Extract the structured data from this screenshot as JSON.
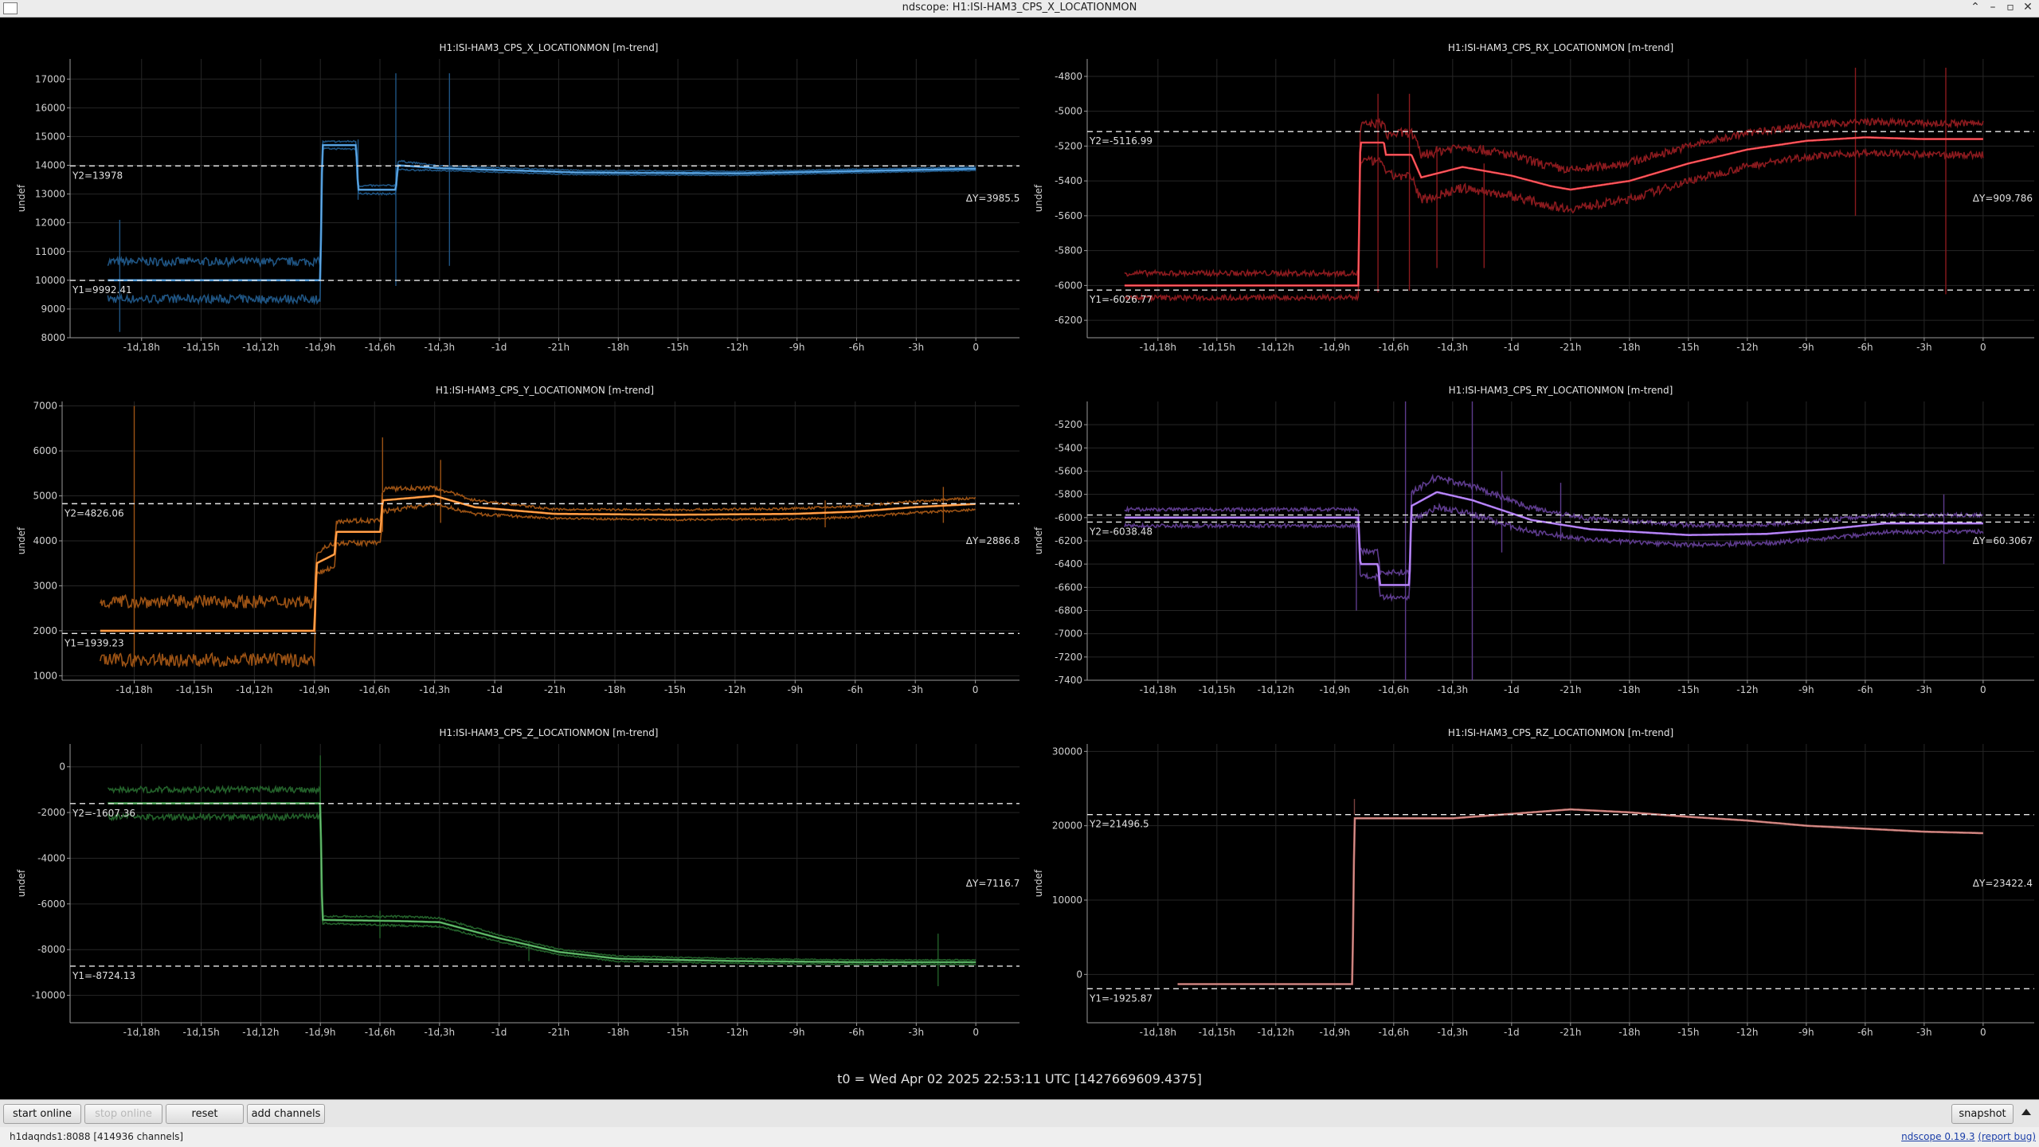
{
  "window": {
    "title": "ndscope: H1:ISI-HAM3_CPS_X_LOCATIONMON",
    "controls": [
      "⌃",
      "–",
      "▫",
      "✕"
    ]
  },
  "time_ticks": [
    "-1d,18h",
    "-1d,15h",
    "-1d,12h",
    "-1d,9h",
    "-1d,6h",
    "-1d,3h",
    "-1d",
    "-21h",
    "-18h",
    "-15h",
    "-12h",
    "-9h",
    "-6h",
    "-3h",
    "0"
  ],
  "time_tick_hours": [
    -42,
    -39,
    -36,
    -33,
    -30,
    -27,
    -24,
    -21,
    -18,
    -15,
    -12,
    -9,
    -6,
    -3,
    0
  ],
  "ylabel": "undef",
  "plots": [
    {
      "id": "x",
      "title": "H1:ISI-HAM3_CPS_X_LOCATIONMON [m-trend]",
      "color": "#3a8fd6",
      "dim_color": "#1f5482",
      "ylim": [
        8000,
        17700
      ],
      "yticks": [
        8000,
        9000,
        10000,
        11000,
        12000,
        13000,
        14000,
        15000,
        16000,
        17000
      ],
      "y1": 9992.41,
      "y1_label": "Y1=9992.41",
      "y2": 13978,
      "y2_label": "Y2=13978",
      "delta_label": "ΔY=3985.55",
      "profile": [
        [
          -43.7,
          10000
        ],
        [
          -33.0,
          10000
        ],
        [
          -32.9,
          14700
        ],
        [
          -31.2,
          14700
        ],
        [
          -31.1,
          13150
        ],
        [
          -29.2,
          13150
        ],
        [
          -29.1,
          14000
        ],
        [
          -27.0,
          13900
        ],
        [
          -20,
          13750
        ],
        [
          -12,
          13720
        ],
        [
          -6,
          13800
        ],
        [
          0,
          13880
        ]
      ],
      "band": [
        [
          -43.7,
          650
        ],
        [
          -33,
          650
        ],
        [
          -32.9,
          120
        ],
        [
          -29,
          150
        ],
        [
          -27,
          80
        ],
        [
          0,
          60
        ]
      ],
      "spikes": [
        [
          -29.2,
          9800,
          17200
        ],
        [
          -26.5,
          10500,
          17200
        ],
        [
          -43.1,
          8200,
          12100
        ],
        [
          -31.1,
          12800,
          14900
        ]
      ]
    },
    {
      "id": "rx",
      "title": "H1:ISI-HAM3_CPS_RX_LOCATIONMON [m-trend]",
      "color": "#f0343b",
      "dim_color": "#8a1a1e",
      "ylim": [
        -6300,
        -4700
      ],
      "yticks": [
        -6200,
        -6000,
        -5800,
        -5600,
        -5400,
        -5200,
        -5000,
        -4800
      ],
      "y1": -6026.77,
      "y1_label": "Y1=-6026.77",
      "y2": -5116.99,
      "y2_label": "Y2=-5116.99",
      "delta_label": "ΔY=909.786",
      "profile": [
        [
          -43.7,
          -6000
        ],
        [
          -31.8,
          -6000
        ],
        [
          -31.7,
          -5180
        ],
        [
          -30.5,
          -5180
        ],
        [
          -30.4,
          -5250
        ],
        [
          -29.1,
          -5250
        ],
        [
          -28.6,
          -5380
        ],
        [
          -26.5,
          -5320
        ],
        [
          -24,
          -5370
        ],
        [
          -22,
          -5430
        ],
        [
          -21,
          -5450
        ],
        [
          -18,
          -5400
        ],
        [
          -15,
          -5300
        ],
        [
          -12,
          -5220
        ],
        [
          -9,
          -5170
        ],
        [
          -6,
          -5150
        ],
        [
          -3,
          -5160
        ],
        [
          0,
          -5160
        ]
      ],
      "band": [
        [
          -43.7,
          70
        ],
        [
          -31.8,
          70
        ],
        [
          -31.7,
          100
        ],
        [
          -29,
          130
        ],
        [
          -26,
          120
        ],
        [
          -21,
          110
        ],
        [
          -9,
          90
        ],
        [
          0,
          90
        ]
      ],
      "spikes": [
        [
          -30.8,
          -6040,
          -4900
        ],
        [
          -29.2,
          -6030,
          -4900
        ],
        [
          -27.8,
          -5900,
          -5200
        ],
        [
          -6.5,
          -5600,
          -4750
        ],
        [
          -1.9,
          -6050,
          -4750
        ],
        [
          -25.4,
          -5900,
          -5300
        ]
      ]
    },
    {
      "id": "y",
      "title": "H1:ISI-HAM3_CPS_Y_LOCATIONMON [m-trend]",
      "color": "#ff8c28",
      "dim_color": "#9b5214",
      "ylim": [
        900,
        7100
      ],
      "yticks": [
        1000,
        2000,
        3000,
        4000,
        5000,
        6000,
        7000
      ],
      "y1": 1939.23,
      "y1_label": "Y1=1939.23",
      "y2": 4826.06,
      "y2_label": "Y2=4826.06",
      "delta_label": "ΔY=2886.83",
      "profile": [
        [
          -43.7,
          2000
        ],
        [
          -33.0,
          2000
        ],
        [
          -32.9,
          3500
        ],
        [
          -32.0,
          3700
        ],
        [
          -31.9,
          4200
        ],
        [
          -29.7,
          4200
        ],
        [
          -29.6,
          4900
        ],
        [
          -27.0,
          5000
        ],
        [
          -25,
          4750
        ],
        [
          -21,
          4600
        ],
        [
          -15,
          4580
        ],
        [
          -9,
          4600
        ],
        [
          -6,
          4650
        ],
        [
          -3,
          4750
        ],
        [
          0,
          4820
        ]
      ],
      "band": [
        [
          -43.7,
          650
        ],
        [
          -33,
          650
        ],
        [
          -32.9,
          250
        ],
        [
          -29.6,
          250
        ],
        [
          -27,
          180
        ],
        [
          -21,
          100
        ],
        [
          0,
          130
        ]
      ],
      "spikes": [
        [
          -42.0,
          1200,
          7000
        ],
        [
          -29.6,
          4200,
          6300
        ],
        [
          -26.7,
          4400,
          5800
        ],
        [
          -1.6,
          4400,
          5200
        ],
        [
          -7.5,
          4300,
          4900
        ]
      ]
    },
    {
      "id": "ry",
      "title": "H1:ISI-HAM3_CPS_RY_LOCATIONMON [m-trend]",
      "color": "#a66df0",
      "dim_color": "#5d3b8c",
      "ylim": [
        -7400,
        -5000
      ],
      "yticks": [
        -7400,
        -7200,
        -7000,
        -6800,
        -6600,
        -6400,
        -6200,
        -6000,
        -5800,
        -5600,
        -5400,
        -5200
      ],
      "y1": -5977.81,
      "y1_label": "",
      "y2": -6038.48,
      "y2_label": "Y2=-6038.48",
      "delta_label": "ΔY=60.3067",
      "profile": [
        [
          -43.7,
          -6000
        ],
        [
          -31.8,
          -6000
        ],
        [
          -31.7,
          -6400
        ],
        [
          -30.8,
          -6400
        ],
        [
          -30.7,
          -6580
        ],
        [
          -29.2,
          -6580
        ],
        [
          -29.1,
          -5900
        ],
        [
          -27.8,
          -5780
        ],
        [
          -26,
          -5850
        ],
        [
          -23,
          -6020
        ],
        [
          -20,
          -6100
        ],
        [
          -15,
          -6150
        ],
        [
          -11,
          -6140
        ],
        [
          -8,
          -6100
        ],
        [
          -5,
          -6050
        ],
        [
          -2,
          -6050
        ],
        [
          0,
          -6050
        ]
      ],
      "band": [
        [
          -43.7,
          70
        ],
        [
          -31.8,
          70
        ],
        [
          -31.7,
          110
        ],
        [
          -29.2,
          110
        ],
        [
          -28,
          130
        ],
        [
          -20,
          90
        ],
        [
          0,
          70
        ]
      ],
      "spikes": [
        [
          -29.4,
          -7400,
          -5000
        ],
        [
          -26.0,
          -7400,
          -5000
        ],
        [
          -24.5,
          -6300,
          -5600
        ],
        [
          -21.5,
          -6200,
          -5700
        ],
        [
          -2.0,
          -6400,
          -5800
        ],
        [
          -31.9,
          -6800,
          -6000
        ]
      ]
    },
    {
      "id": "z",
      "title": "H1:ISI-HAM3_CPS_Z_LOCATIONMON [m-trend]",
      "color": "#3fa34a",
      "dim_color": "#23602a",
      "ylim": [
        -11200,
        1000
      ],
      "yticks": [
        -10000,
        -8000,
        -6000,
        -4000,
        -2000,
        0
      ],
      "y1": -8724.13,
      "y1_label": "Y1=-8724.13",
      "y2": -1607.36,
      "y2_label": "Y2=-1607.36",
      "delta_label": "ΔY=7116.77",
      "profile": [
        [
          -43.7,
          -1600
        ],
        [
          -33.0,
          -1600
        ],
        [
          -32.9,
          -6700
        ],
        [
          -29,
          -6750
        ],
        [
          -27,
          -6800
        ],
        [
          -24,
          -7500
        ],
        [
          -21,
          -8100
        ],
        [
          -18,
          -8400
        ],
        [
          -12,
          -8500
        ],
        [
          -6,
          -8550
        ],
        [
          0,
          -8550
        ]
      ],
      "band": [
        [
          -43.7,
          600
        ],
        [
          -33,
          600
        ],
        [
          -32.9,
          150
        ],
        [
          -29,
          200
        ],
        [
          -21,
          120
        ],
        [
          -9,
          100
        ],
        [
          0,
          100
        ]
      ],
      "spikes": [
        [
          -33.0,
          -2500,
          500
        ],
        [
          -30,
          -7500,
          -6300
        ],
        [
          -22.5,
          -8500,
          -7700
        ],
        [
          -1.9,
          -9600,
          -7300
        ]
      ]
    },
    {
      "id": "rz",
      "title": "H1:ISI-HAM3_CPS_RZ_LOCATIONMON [m-trend]",
      "color": "#c46f6a",
      "dim_color": "#7a4240",
      "ylim": [
        -6500,
        31000
      ],
      "yticks": [
        0,
        10000,
        20000,
        30000
      ],
      "y1": -1925.87,
      "y1_label": "Y1=-1925.87",
      "y2": 21496.5,
      "y2_label": "Y2=21496.5",
      "delta_label": "ΔY=23422.4",
      "profile": [
        [
          -41,
          -1300
        ],
        [
          -32.1,
          -1300
        ],
        [
          -32.0,
          21000
        ],
        [
          -27,
          21000
        ],
        [
          -24,
          21600
        ],
        [
          -21,
          22200
        ],
        [
          -18,
          21800
        ],
        [
          -15,
          21200
        ],
        [
          -12,
          20700
        ],
        [
          -9,
          20000
        ],
        [
          -6,
          19600
        ],
        [
          -3,
          19200
        ],
        [
          0,
          19000
        ]
      ],
      "band": [
        [
          -41,
          0
        ],
        [
          0,
          0
        ]
      ],
      "spikes": [
        [
          -32.0,
          21500,
          23600
        ]
      ]
    }
  ],
  "t0_label": "t0 = Wed Apr 02 2025 22:53:11 UTC [1427669609.4375]",
  "toolbar": {
    "start_online": "start online",
    "stop_online": "stop online",
    "reset": "reset",
    "add_channels": "add channels",
    "snapshot": "snapshot"
  },
  "status": {
    "server": "h1daqnds1:8088",
    "channels": "[414936 channels]",
    "version_link": "ndscope 0.19.3",
    "report_bug": "(report bug)"
  }
}
